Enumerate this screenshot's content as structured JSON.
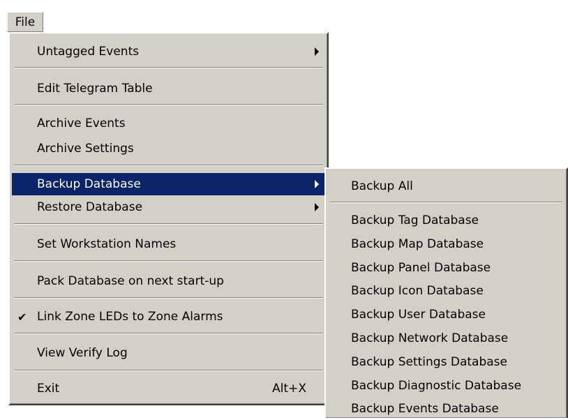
{
  "menubar": {
    "file_label": "File"
  },
  "file_menu": {
    "untagged_events": "Untagged Events",
    "edit_telegram_table": "Edit Telegram Table",
    "archive_events": "Archive Events",
    "archive_settings": "Archive Settings",
    "backup_database": "Backup Database",
    "restore_database": "Restore Database",
    "set_workstation_names": "Set Workstation Names",
    "pack_database": "Pack Database on next start-up",
    "link_zone_leds": "Link Zone LEDs to Zone Alarms",
    "link_zone_leds_checked": true,
    "check_mark": "✔",
    "view_verify_log": "View Verify Log",
    "exit": "Exit",
    "exit_shortcut": "Alt+X"
  },
  "backup_submenu": {
    "items": [
      "Backup All",
      "Backup Tag Database",
      "Backup Map Database",
      "Backup Panel Database",
      "Backup Icon Database",
      "Backup User Database",
      "Backup Network Database",
      "Backup Settings Database",
      "Backup Diagnostic Database",
      "Backup Events Database"
    ]
  },
  "colors": {
    "menu_bg": "#d4d0c8",
    "highlight_bg": "#0a246a",
    "highlight_fg": "#ffffff"
  }
}
